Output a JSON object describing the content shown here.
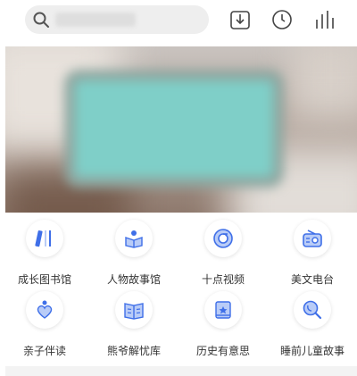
{
  "search": {
    "placeholder": ""
  },
  "toolbar": {
    "download_icon": "download-icon",
    "history_icon": "clock-icon",
    "ranking_icon": "bar-chart-icon"
  },
  "banner": {
    "alt": ""
  },
  "categories": [
    {
      "label": "成长图书馆",
      "icon": "books-icon"
    },
    {
      "label": "人物故事馆",
      "icon": "reading-person-icon"
    },
    {
      "label": "十点视频",
      "icon": "video-disc-icon"
    },
    {
      "label": "美文电台",
      "icon": "radio-icon"
    },
    {
      "label": "亲子伴读",
      "icon": "parent-child-heart-icon"
    },
    {
      "label": "熊爷解忧库",
      "icon": "open-book-icon"
    },
    {
      "label": "历史有意思",
      "icon": "history-book-icon"
    },
    {
      "label": "睡前儿童故事",
      "icon": "moon-search-icon"
    }
  ],
  "colors": {
    "accent": "#3f6fe8",
    "icon_light": "#b9ccf7",
    "text": "#333333"
  }
}
